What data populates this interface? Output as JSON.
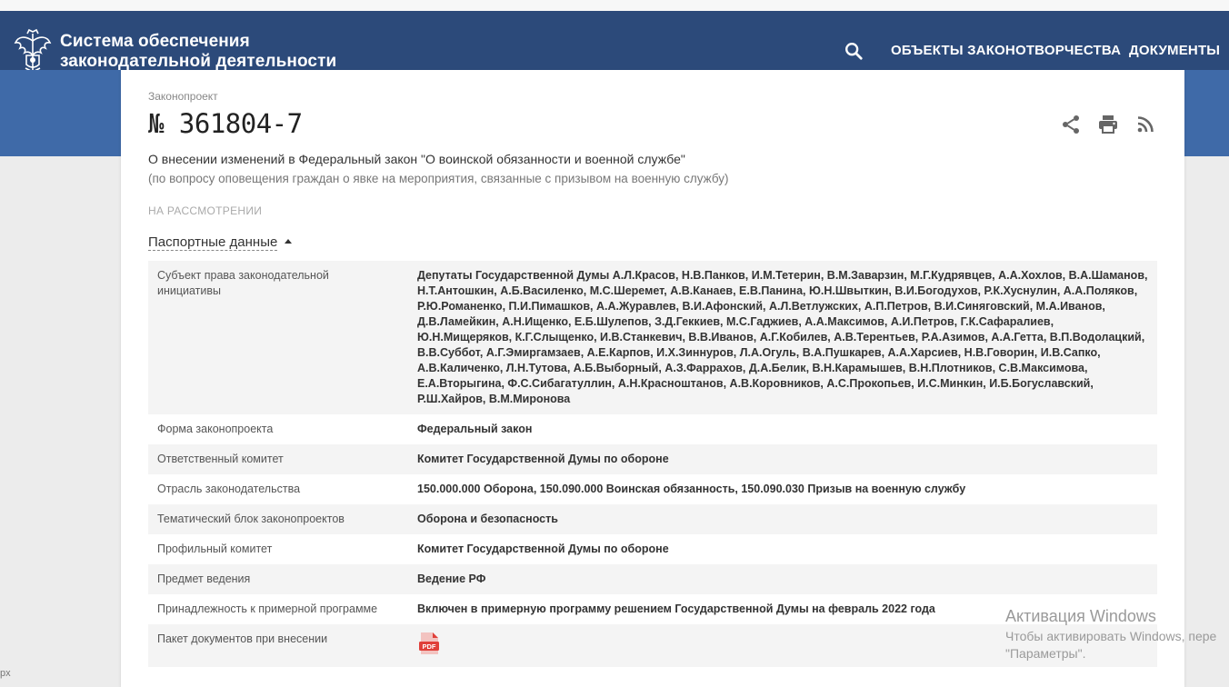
{
  "header": {
    "site_title_line1": "Система обеспечения",
    "site_title_line2": "законодательной деятельности",
    "nav": [
      "ОБЪЕКТЫ ЗАКОНОТВОРЧЕСТВА",
      "ДОКУМЕНТЫ"
    ],
    "search_icon": "search-icon"
  },
  "bill": {
    "label": "Законопроект",
    "number": "№ 361804-7",
    "title": "О внесении изменений в Федеральный закон \"О воинской обязанности и военной службе\"",
    "subtitle": "(по вопросу оповещения граждан о явке на мероприятия, связанные с призывом на военную службу)",
    "status": "НА РАССМОТРЕНИИ",
    "actions": [
      "share-icon",
      "print-icon",
      "rss-icon"
    ]
  },
  "passport": {
    "toggle_label": "Паспортные данные",
    "rows": [
      {
        "key": "Субъект права законодательной инициативы",
        "value": "Депутаты Государственной Думы А.Л.Красов, Н.В.Панков, И.М.Тетерин, В.М.Заварзин, М.Г.Кудрявцев, А.А.Хохлов, В.А.Шаманов, Н.Т.Антошкин, А.Б.Василенко, М.С.Шеремет, А.В.Канаев, Е.В.Панина, Ю.Н.Швыткин, В.И.Богодухов, Р.К.Хуснулин, А.А.Поляков, Р.Ю.Романенко, П.И.Пимашков, А.А.Журавлев, В.И.Афонский, А.Л.Ветлужских, А.П.Петров, В.И.Синяговский, М.А.Иванов, Д.В.Ламейкин, А.Н.Ищенко, Е.Б.Шулепов, З.Д.Геккиев, М.С.Гаджиев, А.А.Максимов, А.И.Петров, Г.К.Сафаралиев, Ю.Н.Мищеряков, К.Г.Слыщенко, И.В.Станкевич, В.В.Иванов, А.Г.Кобилев, А.В.Терентьев, Р.А.Азимов, А.А.Гетта, В.П.Водолацкий, В.В.Суббот, А.Г.Эмиргамзаев, А.Е.Карпов, И.Х.Зиннуров, Л.А.Огуль, В.А.Пушкарев, А.А.Харсиев, Н.В.Говорин, И.В.Сапко, А.В.Каличенко, Л.Н.Тутова, А.Б.Выборный, А.З.Фаррахов, Д.А.Белик, В.Н.Карамышев, В.Н.Плотников, С.В.Максимова, Е.А.Вторыгина, Ф.С.Сибагатуллин, А.Н.Красноштанов, А.В.Коровников, А.С.Прокопьев, И.С.Минкин, И.Б.Богуславский, Р.Ш.Хайров, В.М.Миронова"
      },
      {
        "key": "Форма законопроекта",
        "value": "Федеральный закон"
      },
      {
        "key": "Ответственный комитет",
        "value": "Комитет Государственной Думы по обороне"
      },
      {
        "key": "Отрасль законодательства",
        "value": "150.000.000 Оборона, 150.090.000 Воинская обязанность, 150.090.030 Призыв на военную службу"
      },
      {
        "key": "Тематический блок законопроектов",
        "value": "Оборона и безопасность"
      },
      {
        "key": "Профильный комитет",
        "value": "Комитет Государственной Думы по обороне"
      },
      {
        "key": "Предмет ведения",
        "value": "Ведение РФ"
      },
      {
        "key": "Принадлежность к примерной программе",
        "value": "Включен в примерную программу решением Государственной Думы на февраль 2022 года"
      },
      {
        "key": "Пакет документов при внесении",
        "value": ""
      }
    ],
    "pdf_label": "PDF"
  },
  "watermark": {
    "title": "Активация Windows",
    "line1": "Чтобы активировать Windows, пере",
    "line2": "\"Параметры\"."
  },
  "edge_text": "px",
  "colors": {
    "navbar": "#2c4a7a",
    "hero": "#3f6aa8",
    "pdf": "#e0403a"
  }
}
